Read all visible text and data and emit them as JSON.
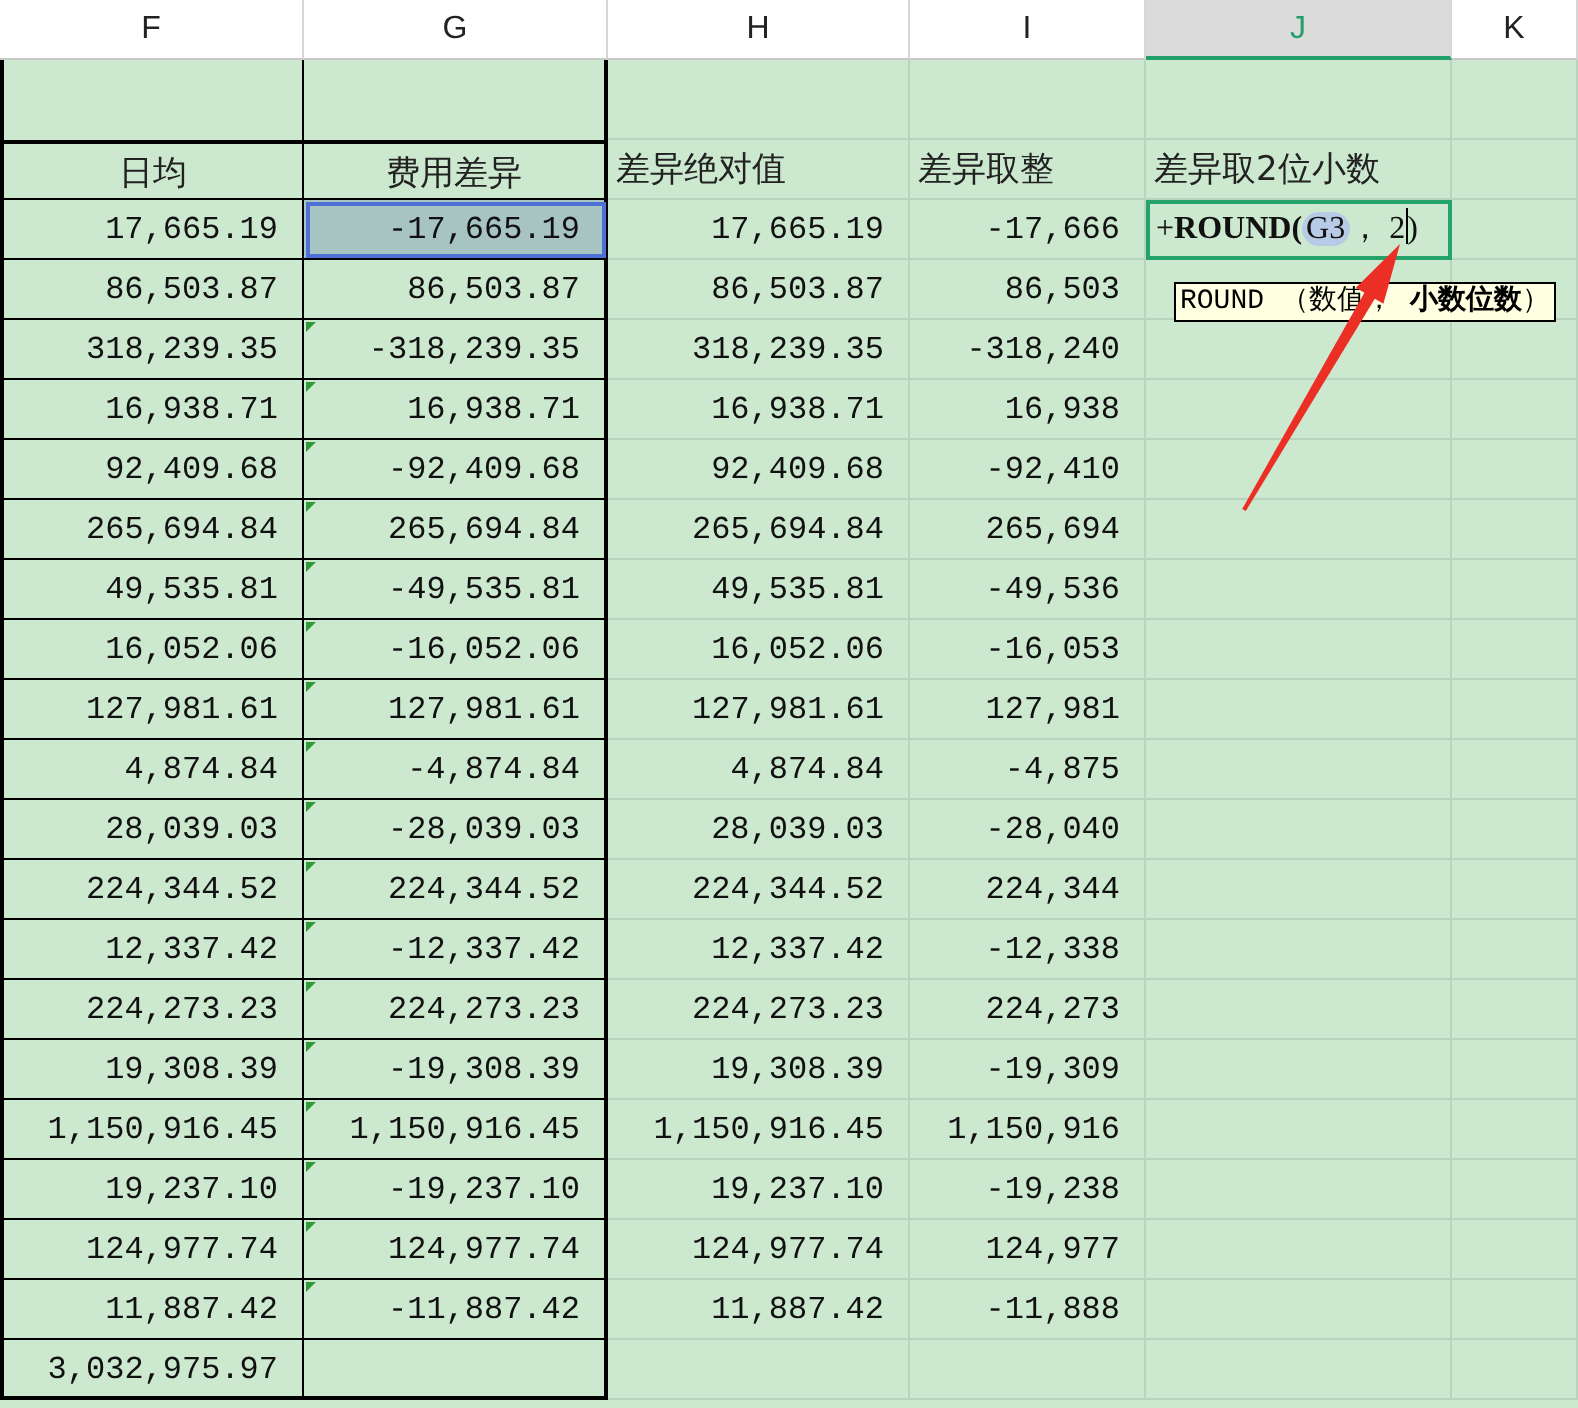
{
  "columns": [
    {
      "letter": "F",
      "selected": false
    },
    {
      "letter": "G",
      "selected": false
    },
    {
      "letter": "H",
      "selected": false
    },
    {
      "letter": "I",
      "selected": false
    },
    {
      "letter": "J",
      "selected": true
    },
    {
      "letter": "K",
      "selected": false
    }
  ],
  "headers": [
    "日均",
    "费用差异",
    "差异绝对值",
    "差异取整",
    "差异取2位小数"
  ],
  "rows": [
    {
      "cells": [
        "17,665.19",
        "-17,665.19",
        "17,665.19",
        "-17,666"
      ],
      "selected": true,
      "flagged": false
    },
    {
      "cells": [
        "86,503.87",
        "86,503.87",
        "86,503.87",
        "86,503"
      ],
      "selected": false,
      "flagged": false
    },
    {
      "cells": [
        "318,239.35",
        "-318,239.35",
        "318,239.35",
        "-318,240"
      ],
      "selected": false,
      "flagged": true
    },
    {
      "cells": [
        "16,938.71",
        "16,938.71",
        "16,938.71",
        "16,938"
      ],
      "selected": false,
      "flagged": true
    },
    {
      "cells": [
        "92,409.68",
        "-92,409.68",
        "92,409.68",
        "-92,410"
      ],
      "selected": false,
      "flagged": true
    },
    {
      "cells": [
        "265,694.84",
        "265,694.84",
        "265,694.84",
        "265,694"
      ],
      "selected": false,
      "flagged": true
    },
    {
      "cells": [
        "49,535.81",
        "-49,535.81",
        "49,535.81",
        "-49,536"
      ],
      "selected": false,
      "flagged": true
    },
    {
      "cells": [
        "16,052.06",
        "-16,052.06",
        "16,052.06",
        "-16,053"
      ],
      "selected": false,
      "flagged": true
    },
    {
      "cells": [
        "127,981.61",
        "127,981.61",
        "127,981.61",
        "127,981"
      ],
      "selected": false,
      "flagged": true
    },
    {
      "cells": [
        "4,874.84",
        "-4,874.84",
        "4,874.84",
        "-4,875"
      ],
      "selected": false,
      "flagged": true
    },
    {
      "cells": [
        "28,039.03",
        "-28,039.03",
        "28,039.03",
        "-28,040"
      ],
      "selected": false,
      "flagged": true
    },
    {
      "cells": [
        "224,344.52",
        "224,344.52",
        "224,344.52",
        "224,344"
      ],
      "selected": false,
      "flagged": true
    },
    {
      "cells": [
        "12,337.42",
        "-12,337.42",
        "12,337.42",
        "-12,338"
      ],
      "selected": false,
      "flagged": true
    },
    {
      "cells": [
        "224,273.23",
        "224,273.23",
        "224,273.23",
        "224,273"
      ],
      "selected": false,
      "flagged": true
    },
    {
      "cells": [
        "19,308.39",
        "-19,308.39",
        "19,308.39",
        "-19,309"
      ],
      "selected": false,
      "flagged": true
    },
    {
      "cells": [
        "1,150,916.45",
        "1,150,916.45",
        "1,150,916.45",
        "1,150,916"
      ],
      "selected": false,
      "flagged": true
    },
    {
      "cells": [
        "19,237.10",
        "-19,237.10",
        "19,237.10",
        "-19,238"
      ],
      "selected": false,
      "flagged": true
    },
    {
      "cells": [
        "124,977.74",
        "124,977.74",
        "124,977.74",
        "124,977"
      ],
      "selected": false,
      "flagged": true
    },
    {
      "cells": [
        "11,887.42",
        "-11,887.42",
        "11,887.42",
        "-11,888"
      ],
      "selected": false,
      "flagged": true
    }
  ],
  "total": "3,032,975.97",
  "editor": {
    "prefix": "+",
    "function": "ROUND(",
    "reference": "G3",
    "argument": "， 2",
    "close": ")"
  },
  "tooltip": "ROUND （数值， **小数位数**）"
}
